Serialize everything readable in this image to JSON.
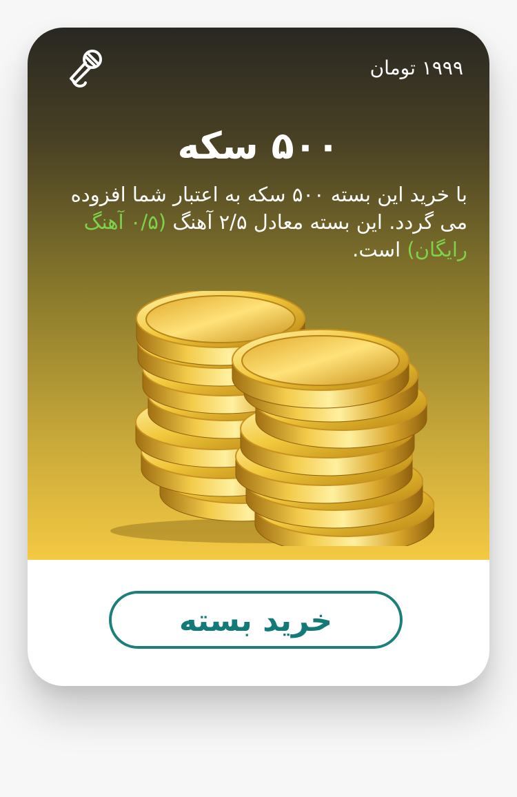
{
  "card": {
    "price": "۱۹۹۹ تومان",
    "icon": "microphone-icon",
    "title": "۵۰۰ سکه",
    "description": {
      "part1": "با خرید این بسته ۵۰۰ سکه به اعتبار شما افزوده می گردد. این بسته معادل ۲/۵ آهنگ ",
      "highlight": "(۰/۵ آهنگ رایگان)",
      "part2": " است."
    },
    "image": "gold-coins-stack-image",
    "buy_button": "خرید بسته"
  },
  "colors": {
    "highlight": "#7fd34a",
    "button": "#1d7f7c",
    "gradient_top": "#292722",
    "gradient_bottom": "#f4c943"
  }
}
